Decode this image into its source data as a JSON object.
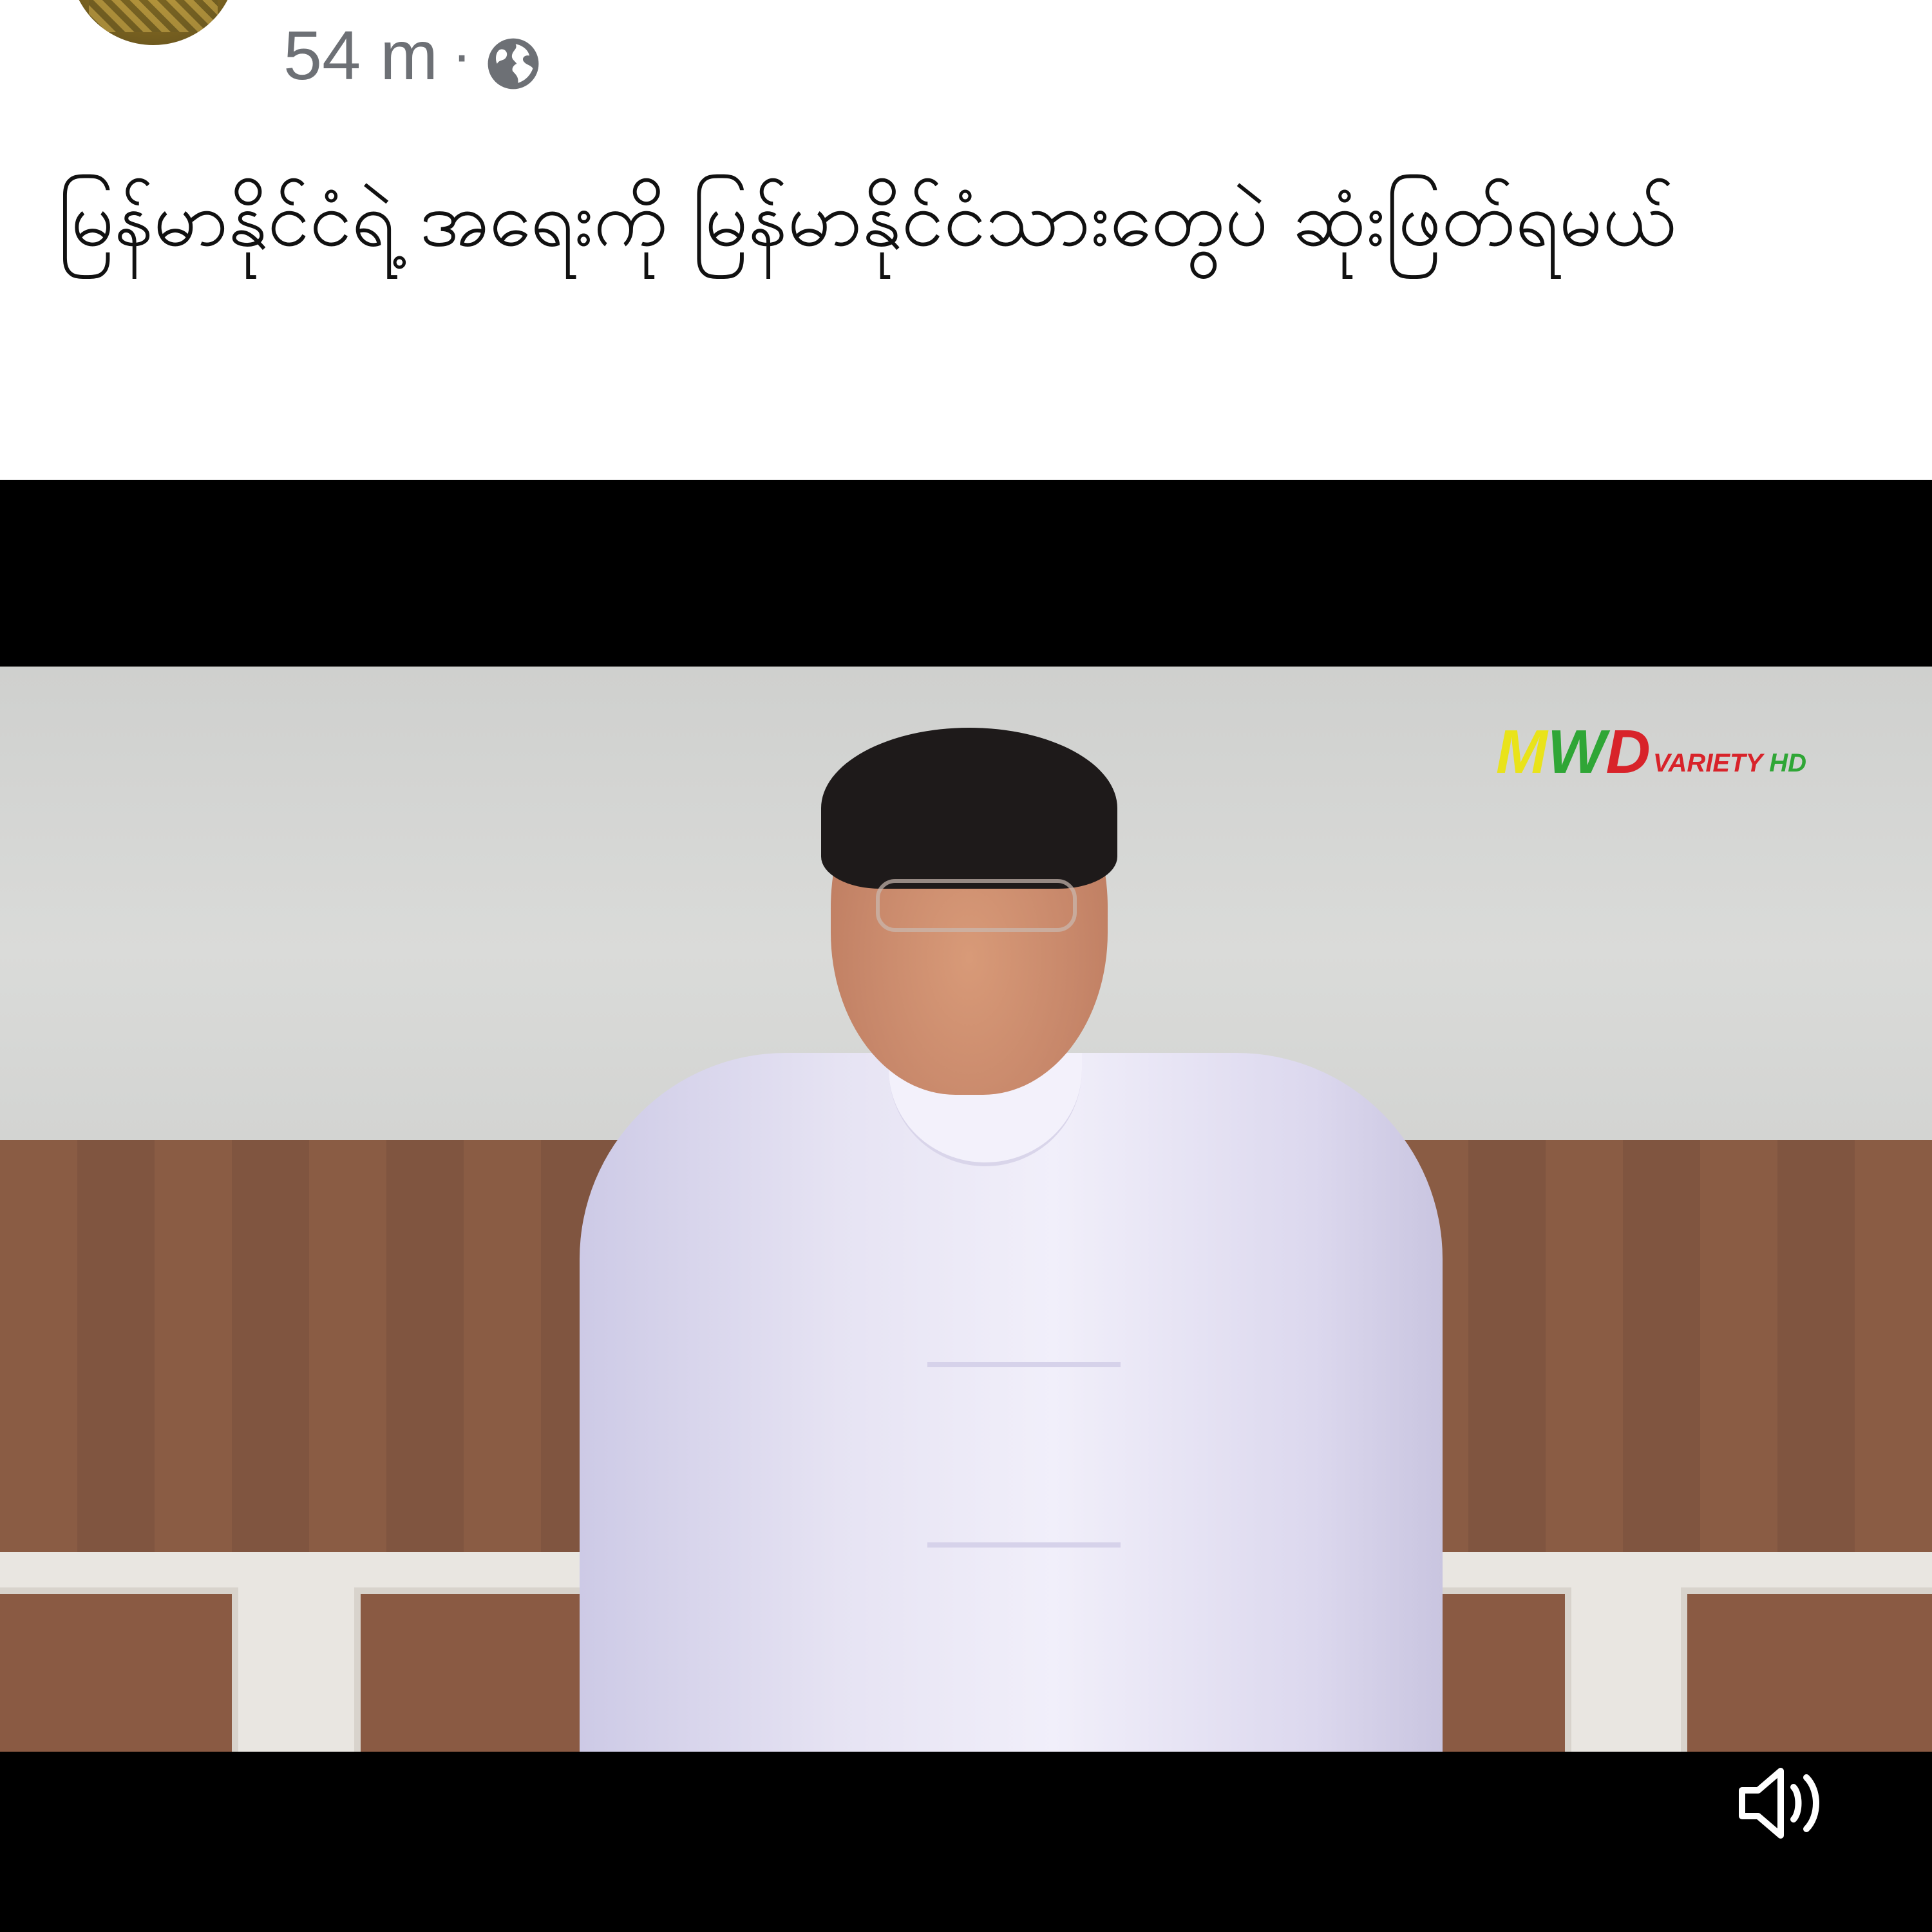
{
  "post": {
    "time": "54 m",
    "separator": "·",
    "privacy_icon": "globe-icon",
    "caption": "မြန်မာနိုင်ငံရဲ့ အရေးကို မြန်မာနိုင်ငံသားတွေပဲ ဆုံးဖြတ်ရမယ်"
  },
  "video": {
    "watermark": {
      "letters": [
        "M",
        "W",
        "D"
      ],
      "variety": "VARIETY",
      "hd": "HD",
      "colors": {
        "m": "#e9e31a",
        "w": "#2fa636",
        "d": "#d8232a"
      }
    },
    "volume_icon": "volume-icon"
  },
  "colors": {
    "meta_text": "#6d7075",
    "caption_text": "#111111",
    "video_background": "#000000"
  }
}
